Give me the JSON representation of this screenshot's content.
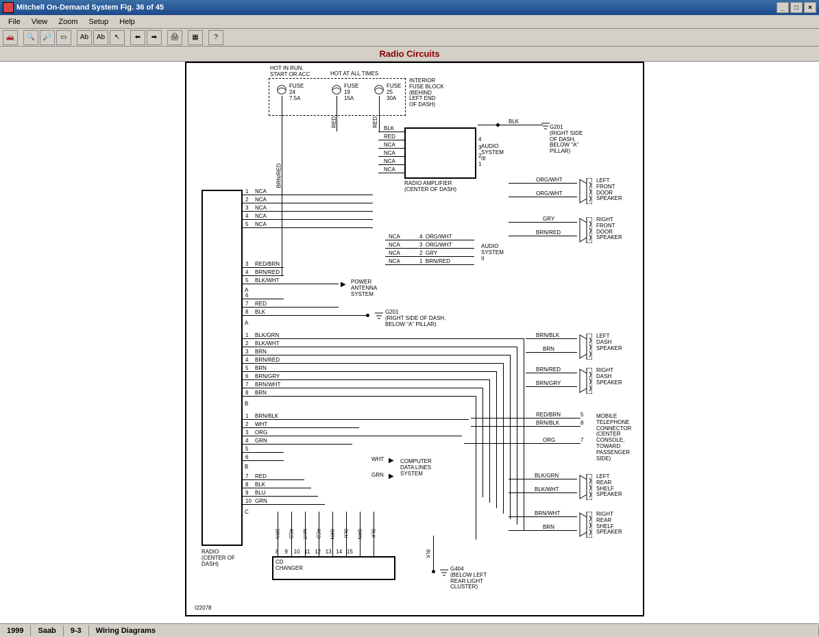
{
  "window": {
    "title": "Mitchell On-Demand System Fig. 36 of 45",
    "min": "_",
    "max": "□",
    "close": "×"
  },
  "menu": {
    "items": [
      "File",
      "View",
      "Zoom",
      "Setup",
      "Help"
    ]
  },
  "toolbar_icons": [
    "car",
    "zoom-out",
    "zoom-in",
    "zoom-fit",
    "text1",
    "text2",
    "pointer",
    "back",
    "fwd",
    "print",
    "page",
    "help"
  ],
  "heading": "Radio Circuits",
  "status": {
    "year": "1999",
    "make": "Saab",
    "model": "9-3",
    "section": "Wiring Diagrams"
  },
  "labels": {
    "hot_run": "HOT IN RUN,\nSTART OR ACC",
    "hot_all": "HOT AT ALL TIMES",
    "fuse24": "FUSE\n24\n7.5A",
    "fuse19": "FUSE\n19\n15A",
    "fuse25": "FUSE\n25\n30A",
    "interior_block": "INTERIOR\nFUSE BLOCK\n(BEHIND\nLEFT END\nOF DASH)",
    "g201": "G201\n(RIGHT SIDE\nOF DASH,\nBELOW \"A\"\nPILLAR)",
    "radio_amp": "RADIO AMPLIFIER\n(CENTER OF DASH)",
    "audio3": "AUDIO\nSYSTEM\nIII",
    "audio2": "AUDIO\nSYSTEM\nII",
    "lf_spk": "LEFT\nFRONT\nDOOR\nSPEAKER",
    "rf_spk": "RIGHT\nFRONT\nDOOR\nSPEAKER",
    "power_ant": "POWER\nANTENNA\nSYSTEM",
    "g201b": "G201\n(RIGHT SIDE OF DASH,\nBELOW \"A\" PILLAR)",
    "ld_spk": "LEFT\nDASH\nSPEAKER",
    "rd_spk": "RIGHT\nDASH\nSPEAKER",
    "mobile": "MOBILE\nTELEPHONE\nCONNECTOR\n(CENTER\nCONSOLE,\nTOWARD\nPASSENGER\nSIDE)",
    "lr_spk": "LEFT\nREAR\nSHELF\nSPEAKER",
    "rr_spk": "RIGHT\nREAR\nSHELF\nSPEAKER",
    "comp_data": "COMPUTER\nDATA LINES\nSYSTEM",
    "cd_changer": "CD\nCHANGER",
    "radio": "RADIO\n(CENTER OF\nDASH)",
    "g404": "G404\n(BELOW LEFT\nREAR LIGHT\nCLUSTER)",
    "ref": "I22078"
  },
  "wires": {
    "brn_red_v": "BRN/RED",
    "red_v": "RED",
    "red_v2": "RED",
    "blk1": "BLK",
    "red1": "RED",
    "nca": "NCA",
    "blk_out": "BLK",
    "org_wht": "ORG/WHT",
    "gry": "GRY",
    "brn_red_sp": "BRN/RED",
    "row_a1": "1",
    "row_a2": "2",
    "row_a3": "3",
    "row_a4": "4",
    "row_a5": "5",
    "row_a_nca": "NCA",
    "row_b3": "3",
    "row_b4": "4",
    "row_b5": "5",
    "row_b_label": "A",
    "redbrn": "RED/BRN",
    "brnred": "BRN/RED",
    "blkwht": "BLK/WHT",
    "b6": "6",
    "b7": "7",
    "b8": "8",
    "red": "RED",
    "blk": "BLK",
    "grp_a": "A",
    "grp_b": "B",
    "blkgrn": "BLK/GRN",
    "blkwht2": "BLK/WHT",
    "brn": "BRN",
    "brnred2": "BRN/RED",
    "brn2": "BRN",
    "brngry": "BRN/GRY",
    "brnwht": "BRN/WHT",
    "brn3": "BRN",
    "c1": "1",
    "c2": "2",
    "c3": "3",
    "c4": "4",
    "c5": "5",
    "c6": "6",
    "c7": "7",
    "c8": "8",
    "brnblk": "BRN/BLK",
    "wht": "WHT",
    "org": "ORG",
    "grn": "GRN",
    "d1": "1",
    "d2": "2",
    "d3": "3",
    "d4": "4",
    "d5": "5",
    "d6": "6",
    "d_b": "B",
    "red2": "RED",
    "blk2": "BLK",
    "blu": "BLU",
    "grn2": "GRN",
    "e7": "7",
    "e8": "8",
    "e9": "9",
    "e10": "10",
    "e_c": "C",
    "wht_cdl": "WHT",
    "grn_cdl": "GRN",
    "cd_pins": "BRN  RED  WHT  RED  GRN  BLU  GRN  BLK",
    "cd_nums": "8    9    10   11   12   13   14   15",
    "blk_g404": "BLK",
    "brnblk_ld": "BRN/BLK",
    "brn_ld": "BRN",
    "brnred_rd": "BRN/RED",
    "brngry_rd": "BRN/GRY",
    "redbrn_mb": "RED/BRN",
    "brnblk_mb": "BRN/BLK",
    "org_mb": "ORG",
    "pin5": "5",
    "pin8": "8",
    "pin7": "7",
    "blkgrn_lr": "BLK/GRN",
    "blkwht_lr": "BLK/WHT",
    "brnwht_rr": "BRN/WHT",
    "brn_rr": "BRN",
    "amp_pins": "4  3  2  1",
    "sys2_pins_org": "4  ORG/WHT",
    "sys2_pins_org2": "3  ORG/WHT",
    "sys2_pins_gry": "2  GRY",
    "sys2_pins_brn": "1  BRN/RED"
  }
}
